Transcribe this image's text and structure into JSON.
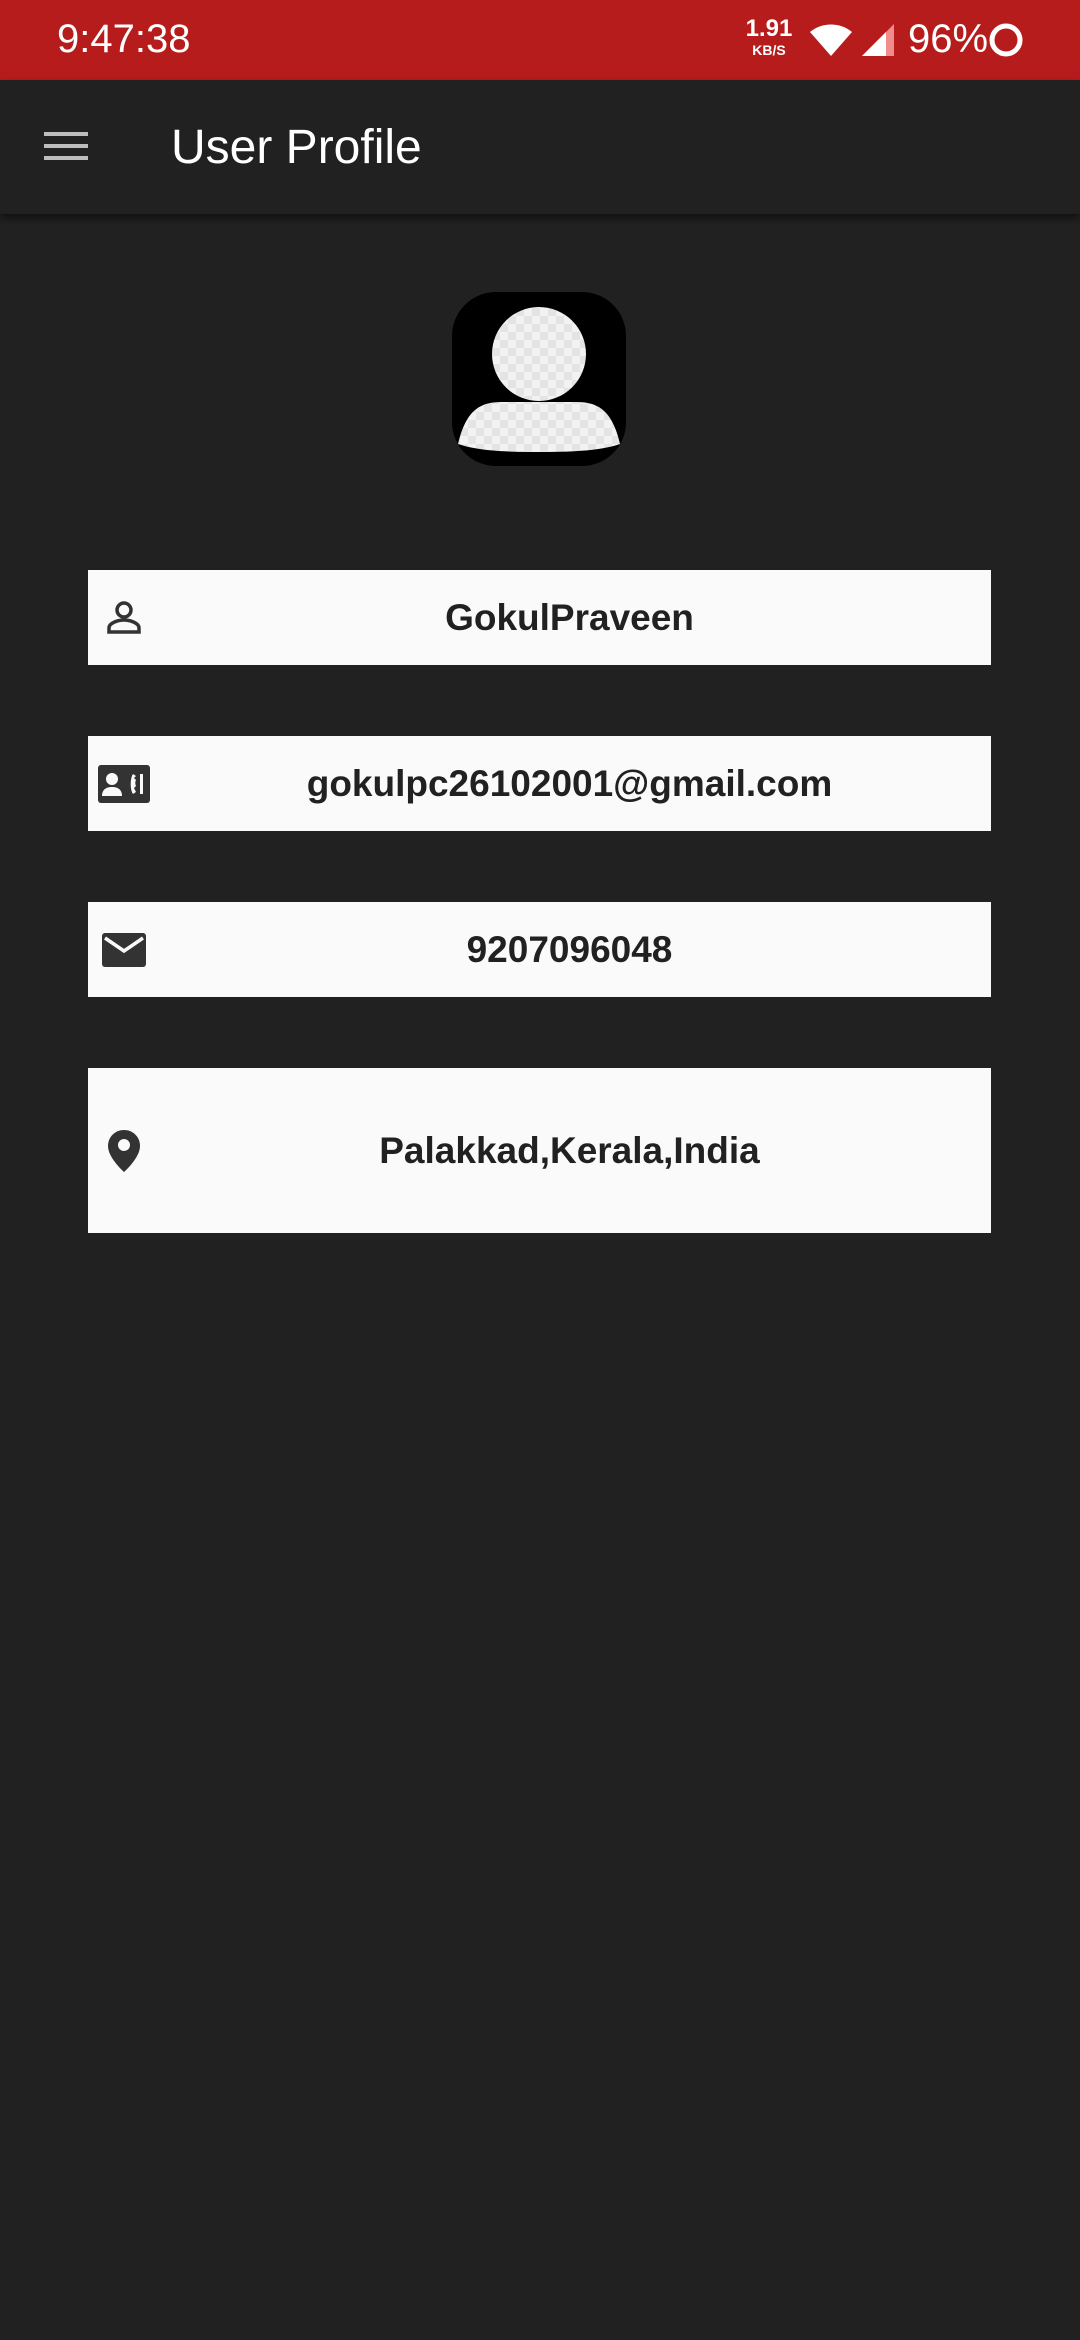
{
  "status_bar": {
    "time": "9:47:38",
    "net_speed_value": "1.91",
    "net_speed_unit": "KB/S",
    "battery_percent": "96%",
    "color": "#b71c1c"
  },
  "app_bar": {
    "title": "User Profile",
    "menu_icon": "hamburger-menu-icon"
  },
  "profile": {
    "avatar_icon": "default-avatar-icon",
    "fields": {
      "name": {
        "icon": "person-icon",
        "value": "GokulPraveen"
      },
      "email": {
        "icon": "contact-card-icon",
        "value": "gokulpc26102001@gmail.com"
      },
      "phone": {
        "icon": "envelope-icon",
        "value": "9207096048"
      },
      "location": {
        "icon": "location-pin-icon",
        "value": "Palakkad,Kerala,India"
      }
    }
  }
}
